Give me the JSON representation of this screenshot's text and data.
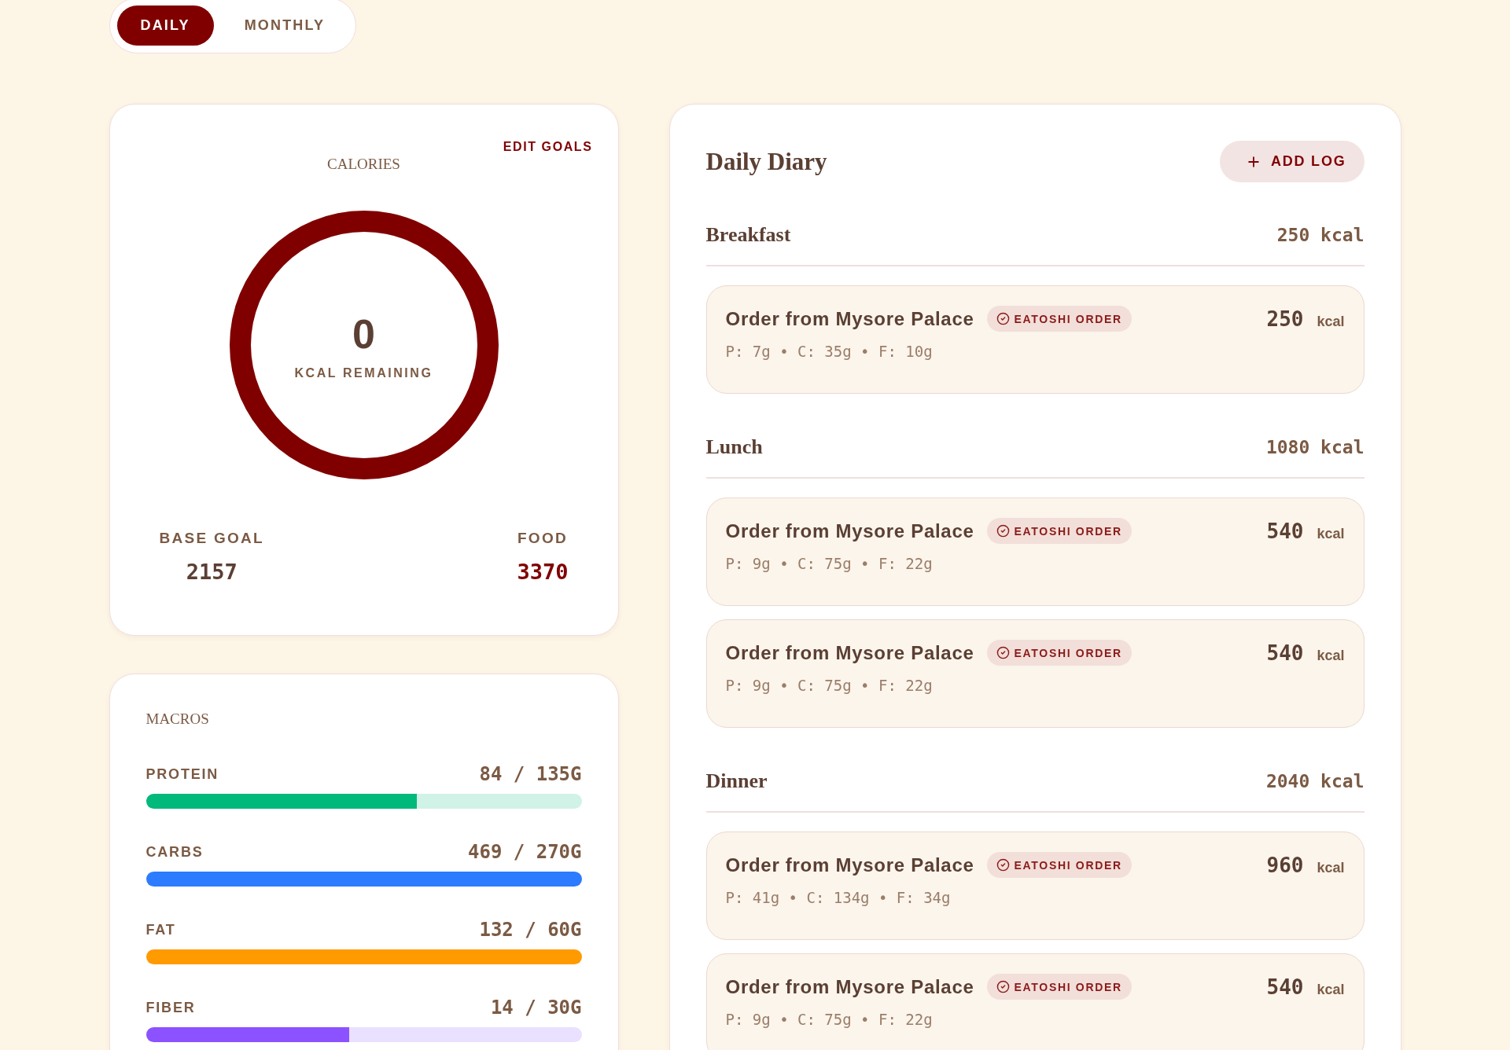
{
  "view_tabs": [
    {
      "label": "DAILY",
      "selected": true
    },
    {
      "label": "MONTHLY",
      "selected": false
    }
  ],
  "calories": {
    "title": "CALORIES",
    "edit_link": "EDIT GOALS",
    "ring": {
      "level": 1,
      "value": "0",
      "caption": "KCAL REMAINING"
    },
    "stats": [
      {
        "kind": "goal",
        "label": "BASE GOAL",
        "value": "2157"
      },
      {
        "kind": "food",
        "label": "FOOD",
        "value": "3370"
      }
    ]
  },
  "macros": {
    "title": "MACROS",
    "items": [
      {
        "name": "PROTEIN",
        "reading": "84 / 135G",
        "level": 0.622,
        "color": "#00b97a"
      },
      {
        "name": "CARBS",
        "reading": "469 / 270G",
        "level": 1,
        "color": "#2d7bff"
      },
      {
        "name": "FAT",
        "reading": "132 / 60G",
        "level": 1,
        "color": "#ff9a00"
      },
      {
        "name": "FIBER",
        "reading": "14 / 30G",
        "level": 0.467,
        "color": "#8c52ff"
      }
    ]
  },
  "diary": {
    "title": "Daily Diary",
    "add_button": "ADD LOG",
    "meals": [
      {
        "name": "Breakfast",
        "total": "250 kcal",
        "entries": [
          {
            "title": "Order from Mysore Palace",
            "badge": "EATOSHI ORDER",
            "macros": "P: 7g • C: 35g • F: 10g",
            "calories": "250",
            "unit": "kcal"
          }
        ]
      },
      {
        "name": "Lunch",
        "total": "1080 kcal",
        "entries": [
          {
            "title": "Order from Mysore Palace",
            "badge": "EATOSHI ORDER",
            "macros": "P: 9g • C: 75g • F: 22g",
            "calories": "540",
            "unit": "kcal"
          },
          {
            "title": "Order from Mysore Palace",
            "badge": "EATOSHI ORDER",
            "macros": "P: 9g • C: 75g • F: 22g",
            "calories": "540",
            "unit": "kcal"
          }
        ]
      },
      {
        "name": "Dinner",
        "total": "2040 kcal",
        "entries": [
          {
            "title": "Order from Mysore Palace",
            "badge": "EATOSHI ORDER",
            "macros": "P: 41g • C: 134g • F: 34g",
            "calories": "960",
            "unit": "kcal"
          },
          {
            "title": "Order from Mysore Palace",
            "badge": "EATOSHI ORDER",
            "macros": "P: 9g • C: 75g • F: 22g",
            "calories": "540",
            "unit": "kcal"
          }
        ]
      }
    ]
  }
}
